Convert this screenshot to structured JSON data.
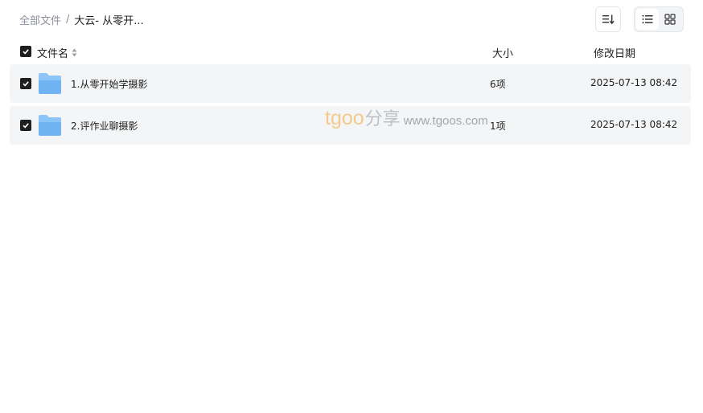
{
  "breadcrumb": {
    "root": "全部文件",
    "separator": "/",
    "current": "大云- 从零开..."
  },
  "toolbar": {
    "sort_icon": "sort-list-icon",
    "view_list_icon": "list-view-icon",
    "view_grid_icon": "grid-view-icon",
    "active_view": "list"
  },
  "table": {
    "columns": {
      "name": "文件名",
      "size": "大小",
      "date": "修改日期"
    },
    "select_all_checked": true,
    "rows": [
      {
        "name": "1.从零开始学摄影",
        "size": "6项",
        "date": "2025-07-13 08:42",
        "checked": true,
        "icon": "folder-icon"
      },
      {
        "name": "2.评作业聊摄影",
        "size": "1项",
        "date": "2025-07-13 08:42",
        "checked": true,
        "icon": "folder-icon"
      }
    ]
  },
  "watermark": {
    "logo": "tgoo",
    "cn": "分享",
    "url": "www.tgoos.com"
  },
  "colors": {
    "row_bg": "#f4f5f6",
    "checkbox": "#1f1f1f",
    "folder_top": "#8ec4f7",
    "folder_body": "#6fb3f2",
    "muted_text": "#8a8f99"
  }
}
